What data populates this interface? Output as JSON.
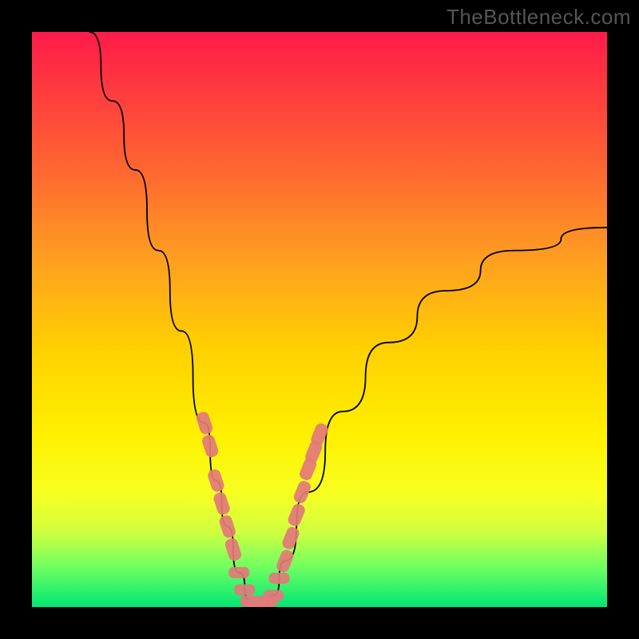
{
  "watermark": "TheBottleneck.com",
  "chart_data": {
    "type": "line",
    "title": "",
    "xlabel": "",
    "ylabel": "",
    "xlim": [
      0,
      100
    ],
    "ylim": [
      0,
      100
    ],
    "series": [
      {
        "name": "bottleneck-curve",
        "x": [
          10,
          14,
          18,
          22,
          26,
          30,
          32,
          34,
          36,
          38,
          40,
          42,
          44,
          48,
          54,
          62,
          72,
          84,
          100
        ],
        "values": [
          100,
          88,
          76,
          62,
          48,
          32,
          22,
          14,
          6,
          1,
          0,
          2,
          8,
          20,
          34,
          46,
          55,
          62,
          66
        ]
      }
    ],
    "markers": {
      "name": "highlight-segments",
      "color": "#e27a7a",
      "points_left": [
        [
          30,
          32
        ],
        [
          31,
          28
        ],
        [
          32,
          22
        ],
        [
          33,
          18
        ],
        [
          34,
          14
        ],
        [
          35,
          10
        ]
      ],
      "points_bottom": [
        [
          36,
          6
        ],
        [
          37,
          3
        ],
        [
          38,
          1
        ],
        [
          39,
          0.5
        ],
        [
          40,
          0
        ],
        [
          41,
          1
        ],
        [
          42,
          2
        ],
        [
          43,
          5
        ]
      ],
      "points_right": [
        [
          44,
          8
        ],
        [
          45,
          12
        ],
        [
          46,
          16
        ],
        [
          47,
          20
        ],
        [
          48,
          24
        ],
        [
          49,
          27
        ],
        [
          50,
          30
        ]
      ]
    },
    "gradient_stops": [
      {
        "pct": 0,
        "color": "#ff1a4a"
      },
      {
        "pct": 25,
        "color": "#ff6a30"
      },
      {
        "pct": 55,
        "color": "#ffd000"
      },
      {
        "pct": 80,
        "color": "#f8ff20"
      },
      {
        "pct": 100,
        "color": "#00e676"
      }
    ],
    "band": {
      "y_from": 78,
      "y_to": 90
    }
  }
}
